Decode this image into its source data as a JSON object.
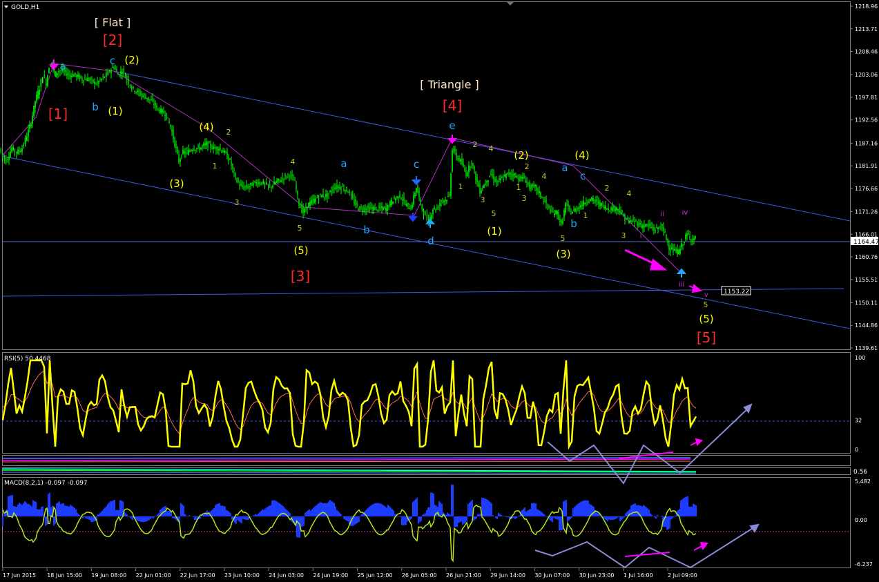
{
  "window": {
    "symbol_title": "GOLD,H1"
  },
  "colors": {
    "background": "#000000",
    "candle": "#00ff00",
    "channel": "#3b5bdb",
    "wave_red": "#ff2a2a",
    "wave_yellow": "#ffff00",
    "wave_cyan": "#1ea7ff",
    "wave_white": "#ffe4c4",
    "wave_small": "#c8c832",
    "magenta": "#ff00ff",
    "rsi_line": "#ffff00",
    "rsi_signal": "#ff6a4d",
    "macd_hist": "#1e3cff",
    "macd_signal": "#b5e61d",
    "projection": "#8a8ad8"
  },
  "chart_data": [
    {
      "type": "line",
      "name": "price",
      "title": "GOLD,H1",
      "ylim": [
        1139.61,
        1218.96
      ],
      "yticks": [
        "1218.96",
        "1213.71",
        "1208.46",
        "1203.06",
        "1197.81",
        "1192.56",
        "1187.16",
        "1181.91",
        "1176.66",
        "1171.26",
        "1166.01",
        "1160.76",
        "1155.51",
        "1150.11",
        "1144.86",
        "1139.61"
      ],
      "current_price": "1164.47",
      "target_price": "1153.22",
      "x_labels": [
        "17 Jun 2015",
        "18 Jun 15:00",
        "19 Jun 08:00",
        "22 Jun 01:00",
        "22 Jun 17:00",
        "23 Jun 10:00",
        "24 Jun 03:00",
        "24 Jun 19:00",
        "25 Jun 12:00",
        "26 Jun 05:00",
        "26 Jun 21:00",
        "29 Jun 14:00",
        "30 Jun 07:00",
        "30 Jun 23:00",
        "1 Jul 16:00",
        "2 Jul 09:00"
      ],
      "price_path": [
        [
          0,
          1186
        ],
        [
          5,
          1184
        ],
        [
          10,
          1183
        ],
        [
          18,
          1186
        ],
        [
          25,
          1185
        ],
        [
          33,
          1186
        ],
        [
          40,
          1189
        ],
        [
          46,
          1192
        ],
        [
          52,
          1197
        ],
        [
          58,
          1200
        ],
        [
          63,
          1203
        ],
        [
          68,
          1201
        ],
        [
          72,
          1205
        ],
        [
          76,
          1206
        ],
        [
          80,
          1203
        ],
        [
          86,
          1204
        ],
        [
          92,
          1204
        ],
        [
          100,
          1203
        ],
        [
          110,
          1203
        ],
        [
          120,
          1202
        ],
        [
          130,
          1202
        ],
        [
          140,
          1201
        ],
        [
          148,
          1202
        ],
        [
          155,
          1203
        ],
        [
          160,
          1204
        ],
        [
          166,
          1205
        ],
        [
          172,
          1203
        ],
        [
          178,
          1204
        ],
        [
          185,
          1202
        ],
        [
          192,
          1200
        ],
        [
          200,
          1199
        ],
        [
          210,
          1198
        ],
        [
          220,
          1197
        ],
        [
          230,
          1195
        ],
        [
          240,
          1194
        ],
        [
          248,
          1191
        ],
        [
          254,
          1187
        ],
        [
          260,
          1183
        ],
        [
          266,
          1185
        ],
        [
          272,
          1185
        ],
        [
          280,
          1186
        ],
        [
          290,
          1186
        ],
        [
          300,
          1187
        ],
        [
          310,
          1186
        ],
        [
          318,
          1186
        ],
        [
          326,
          1185
        ],
        [
          334,
          1183
        ],
        [
          342,
          1179
        ],
        [
          350,
          1177
        ],
        [
          360,
          1177
        ],
        [
          370,
          1178
        ],
        [
          380,
          1178
        ],
        [
          392,
          1177
        ],
        [
          400,
          1178
        ],
        [
          410,
          1179
        ],
        [
          420,
          1180
        ],
        [
          428,
          1178
        ],
        [
          434,
          1173
        ],
        [
          440,
          1171
        ],
        [
          448,
          1173
        ],
        [
          456,
          1174
        ],
        [
          465,
          1175
        ],
        [
          475,
          1175
        ],
        [
          485,
          1177
        ],
        [
          495,
          1177
        ],
        [
          505,
          1176
        ],
        [
          512,
          1174
        ],
        [
          520,
          1172
        ],
        [
          530,
          1172
        ],
        [
          540,
          1172
        ],
        [
          550,
          1172
        ],
        [
          560,
          1172
        ],
        [
          570,
          1174
        ],
        [
          580,
          1175
        ],
        [
          588,
          1173
        ],
        [
          596,
          1172
        ],
        [
          604,
          1177
        ],
        [
          610,
          1173
        ],
        [
          617,
          1170
        ],
        [
          622,
          1169
        ],
        [
          628,
          1172
        ],
        [
          634,
          1172
        ],
        [
          640,
          1174
        ],
        [
          646,
          1174
        ],
        [
          652,
          1175
        ],
        [
          656,
          1186
        ],
        [
          662,
          1184
        ],
        [
          668,
          1183
        ],
        [
          676,
          1180
        ],
        [
          684,
          1183
        ],
        [
          690,
          1179
        ],
        [
          696,
          1176
        ],
        [
          704,
          1178
        ],
        [
          712,
          1180
        ],
        [
          720,
          1178
        ],
        [
          728,
          1179
        ],
        [
          736,
          1180
        ],
        [
          744,
          1180
        ],
        [
          752,
          1179
        ],
        [
          760,
          1179
        ],
        [
          768,
          1177
        ],
        [
          776,
          1177
        ],
        [
          784,
          1175
        ],
        [
          792,
          1173
        ],
        [
          800,
          1171
        ],
        [
          808,
          1171
        ],
        [
          814,
          1168
        ],
        [
          820,
          1173
        ],
        [
          828,
          1171
        ],
        [
          836,
          1172
        ],
        [
          844,
          1173
        ],
        [
          852,
          1174
        ],
        [
          860,
          1174
        ],
        [
          870,
          1173
        ],
        [
          880,
          1172
        ],
        [
          888,
          1172
        ],
        [
          896,
          1172
        ],
        [
          904,
          1170
        ],
        [
          912,
          1169
        ],
        [
          920,
          1169
        ],
        [
          930,
          1168
        ],
        [
          940,
          1168
        ],
        [
          950,
          1167
        ],
        [
          958,
          1168
        ],
        [
          964,
          1166
        ],
        [
          970,
          1163
        ],
        [
          978,
          1162
        ],
        [
          984,
          1162
        ],
        [
          990,
          1164
        ],
        [
          996,
          1166
        ],
        [
          1002,
          1165
        ],
        [
          1008,
          1165
        ]
      ],
      "candles_start": "17 Jun 2015",
      "candles_end": "2 Jul 09:00"
    },
    {
      "type": "line",
      "name": "RSI(5)",
      "header": "RSI(5) 50.4468",
      "ylim": [
        0,
        100
      ],
      "yticks": [
        "100",
        "32",
        "0"
      ],
      "level": "32"
    },
    {
      "type": "bar",
      "name": "MACD(8,2,1)",
      "header": "MACD(8,2,1) -0.097 -0.097",
      "ylim": [
        -6.237,
        5.482
      ],
      "yticks": [
        "5.482",
        "0.00",
        "0",
        "-6.237"
      ]
    }
  ],
  "wave_labels": {
    "flat": "[ Flat ]",
    "triangle": "[ Triangle ]",
    "w1": "[1]",
    "w2": "[2]",
    "w3": "[3]",
    "w4": "[4]",
    "w5": "[5]",
    "p1a": "(1)",
    "p2a": "(2)",
    "p3a": "(3)",
    "p4a": "(4)",
    "p5a": "(5)",
    "p1b": "(1)",
    "p2b": "(2)",
    "p3b": "(3)",
    "p4b": "(4)",
    "p5b": "(5)",
    "a1": "a",
    "b1": "b",
    "c1": "c",
    "a2": "a",
    "b2": "b",
    "c2": "c",
    "d2": "d",
    "e2": "e",
    "a3": "a",
    "b3": "b",
    "c3": "c",
    "s1": "1",
    "s2": "2",
    "s3": "3",
    "s4": "4",
    "s5": "5",
    "t1": "1",
    "t2": "2",
    "t3": "3",
    "t4": "4",
    "t5": "5",
    "u1": "1",
    "u2": "2",
    "u3": "3",
    "u4": "4",
    "u5": "5",
    "v1": "1",
    "v2": "2",
    "v3": "3",
    "v4": "4",
    "v5": "5",
    "r1": "i",
    "r2": "ii",
    "r3": "iii",
    "r4": "iv",
    "r5": "v"
  },
  "indicator_mid": {
    "label": "0.56"
  }
}
